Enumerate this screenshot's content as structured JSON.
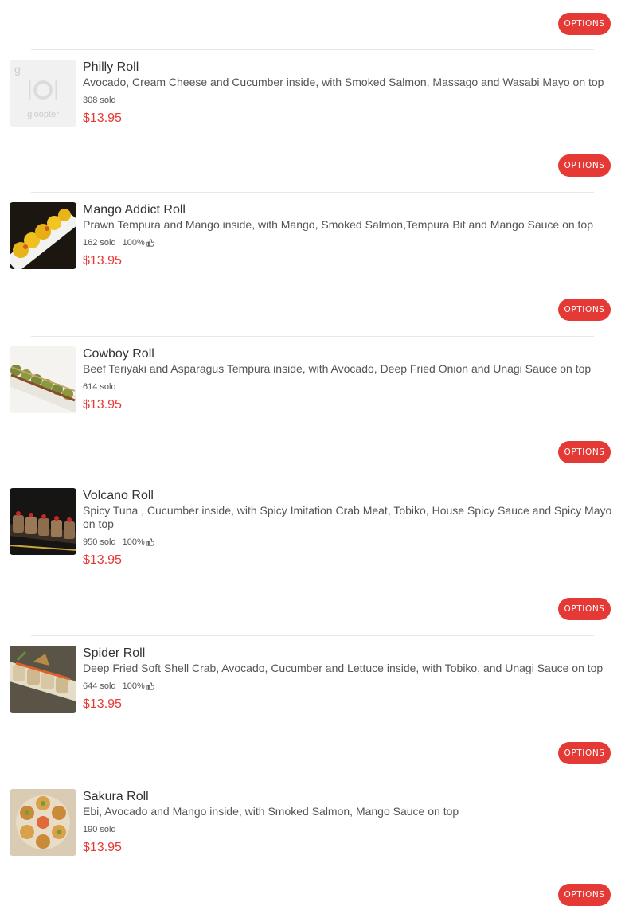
{
  "options_label": "OPTIONS",
  "placeholder": {
    "brand": "gloopter",
    "initial": "g"
  },
  "items": [
    {
      "name": "Philly Roll",
      "description": "Avocado, Cream Cheese and Cucumber inside, with Smoked Salmon, Massago and Wasabi Mayo on top",
      "sold": "308 sold",
      "rating": "",
      "price": "$13.95",
      "image": "placeholder-plate-icon"
    },
    {
      "name": "Mango Addict Roll",
      "description": "Prawn Tempura and Mango inside, with Mango, Smoked Salmon,Tempura Bit and Mango Sauce on top",
      "sold": "162 sold",
      "rating": "100%",
      "price": "$13.95",
      "image": "mango-addict-roll-photo"
    },
    {
      "name": "Cowboy Roll",
      "description": "Beef Teriyaki and Asparagus Tempura inside, with Avocado, Deep Fried Onion and Unagi Sauce on top",
      "sold": "614 sold",
      "rating": "",
      "price": "$13.95",
      "image": "cowboy-roll-photo"
    },
    {
      "name": "Volcano Roll",
      "description": "Spicy Tuna , Cucumber inside, with Spicy Imitation Crab Meat, Tobiko, House Spicy Sauce and Spicy Mayo on top",
      "sold": "950 sold",
      "rating": "100%",
      "price": "$13.95",
      "image": "volcano-roll-photo"
    },
    {
      "name": "Spider Roll",
      "description": "Deep Fried Soft Shell Crab, Avocado, Cucumber and Lettuce inside, with Tobiko, and Unagi Sauce on top",
      "sold": "644 sold",
      "rating": "100%",
      "price": "$13.95",
      "image": "spider-roll-photo"
    },
    {
      "name": "Sakura Roll",
      "description": "Ebi, Avocado and Mango inside, with Smoked Salmon, Mango Sauce on top",
      "sold": "190 sold",
      "rating": "",
      "price": "$13.95",
      "image": "sakura-roll-photo"
    }
  ]
}
